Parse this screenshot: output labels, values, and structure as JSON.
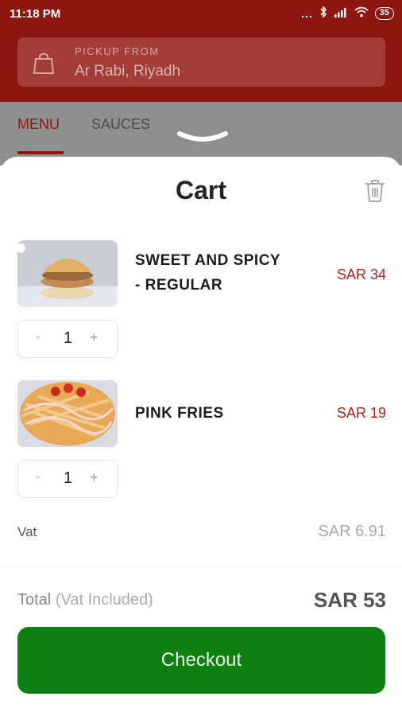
{
  "status_bar": {
    "time": "11:18 PM",
    "dots": "...",
    "battery": "35"
  },
  "header": {
    "pickup_label": "PICKUP FROM",
    "pickup_location": "Ar Rabi, Riyadh"
  },
  "tabs": [
    {
      "label": "MENU",
      "active": true
    },
    {
      "label": "SAUCES",
      "active": false
    }
  ],
  "cart": {
    "title": "Cart",
    "items": [
      {
        "name_line1": "SWEET AND SPICY",
        "name_line2": "- REGULAR",
        "price": "SAR 34",
        "quantity": "1",
        "minus": "-",
        "plus": "+"
      },
      {
        "name_line1": "PINK FRIES",
        "name_line2": "",
        "price": "SAR 19",
        "quantity": "1",
        "minus": "-",
        "plus": "+"
      }
    ],
    "vat_label": "Vat",
    "vat_value": "SAR 6.91",
    "total_label": "Total",
    "total_sub": "(Vat Included)",
    "total_value": "SAR 53",
    "checkout_label": "Checkout"
  },
  "colors": {
    "brand_red": "#8e1611",
    "price_red": "#b3211b",
    "checkout_green": "#0d8011"
  },
  "icons": [
    "bluetooth-icon",
    "signal-icon",
    "wifi-icon",
    "battery-icon",
    "shopping-bag-icon",
    "chevron-down-icon",
    "trash-icon"
  ]
}
